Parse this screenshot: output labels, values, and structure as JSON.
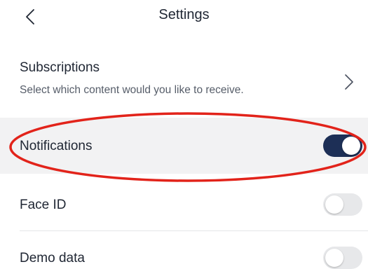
{
  "header": {
    "title": "Settings",
    "back_icon": "chevron-left-icon"
  },
  "subscriptions": {
    "title": "Subscriptions",
    "subtitle": "Select which content would you like to receive.",
    "chevron_icon": "chevron-right-icon"
  },
  "notifications": {
    "label": "Notifications",
    "enabled": true
  },
  "face_id": {
    "label": "Face ID",
    "enabled": false
  },
  "demo_data": {
    "label": "Demo data",
    "enabled": false
  },
  "colors": {
    "toggle_on": "#1d2f56",
    "toggle_off": "#e7e8ea",
    "highlight_ellipse": "#e2231a",
    "selected_row_bg": "#f2f2f3"
  }
}
